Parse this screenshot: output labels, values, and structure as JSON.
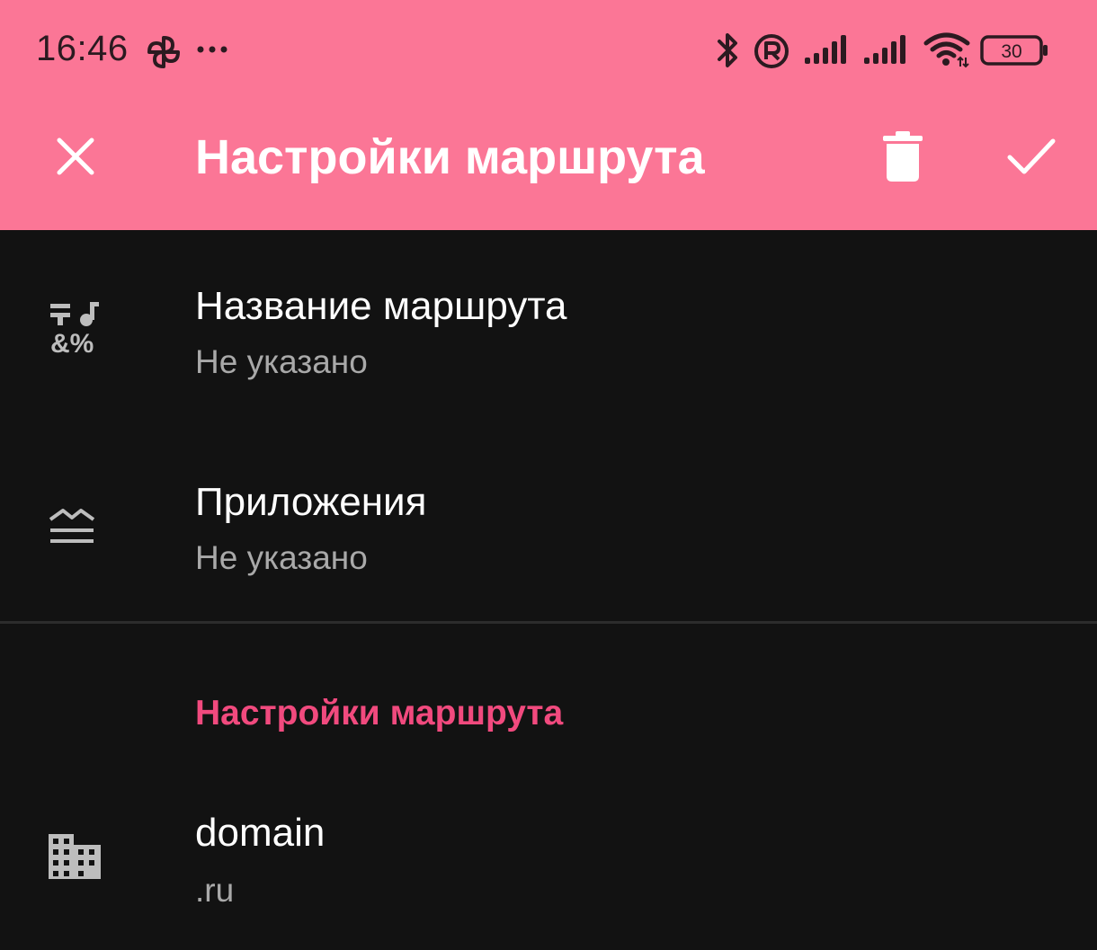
{
  "status_bar": {
    "time": "16:46",
    "more_indicator": "···",
    "battery_level": "30",
    "icons": [
      "pinwheel-icon",
      "more-dots-icon",
      "bluetooth-icon",
      "registered-icon",
      "signal-icon",
      "signal-icon",
      "wifi-icon",
      "battery-icon"
    ]
  },
  "toolbar": {
    "title": "Настройки маршрута",
    "close_icon": "close-icon",
    "delete_icon": "trash-icon",
    "confirm_icon": "check-icon"
  },
  "list": {
    "items": [
      {
        "title": "Название маршрута",
        "subtitle": "Не указано",
        "icon": "text-symbols-icon"
      },
      {
        "title": "Приложения",
        "subtitle": "Не указано",
        "icon": "apps-layers-icon"
      }
    ]
  },
  "section": {
    "title": "Настройки маршрута",
    "items": [
      {
        "title": "domain",
        "subtitle": ".ru",
        "icon": "building-icon"
      }
    ]
  },
  "colors": {
    "accent_bar": "#fb7696",
    "section_header": "#f14a7e",
    "background": "#121212"
  }
}
